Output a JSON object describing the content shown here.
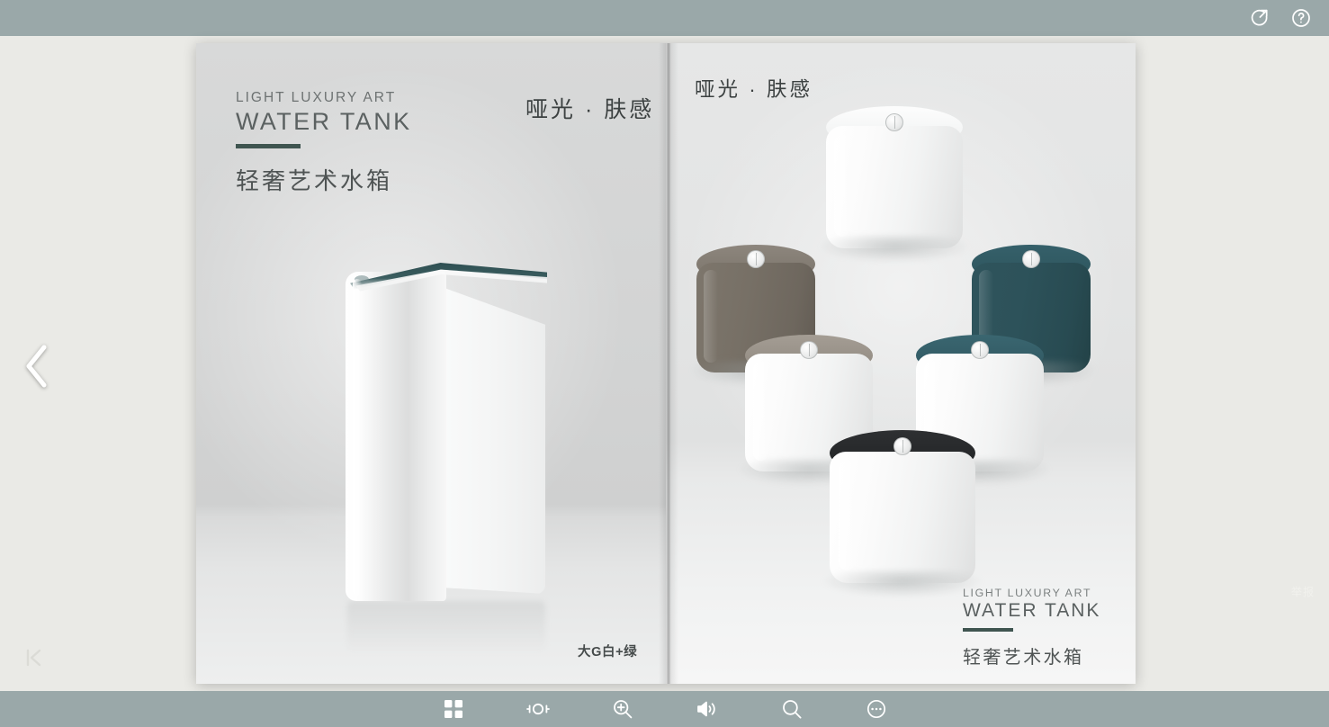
{
  "viewer": {
    "topbar": {
      "icons": [
        {
          "name": "share-icon",
          "label": "Share"
        },
        {
          "name": "help-icon",
          "label": "Help"
        }
      ]
    },
    "bottombar": {
      "icons": [
        {
          "name": "thumbnails-icon",
          "label": "Thumbnails"
        },
        {
          "name": "fit-page-icon",
          "label": "Fit page"
        },
        {
          "name": "zoom-in-icon",
          "label": "Zoom in"
        },
        {
          "name": "sound-icon",
          "label": "Sound"
        },
        {
          "name": "search-icon",
          "label": "Search"
        },
        {
          "name": "more-icon",
          "label": "More"
        }
      ]
    },
    "nav": {
      "prev_label": "Previous page",
      "first_page_label": "First page"
    },
    "report_label": "举报",
    "colors": {
      "bar": "#9aa8a9",
      "background": "#eaeae6",
      "accent_green": "#3f5550",
      "tank_teal": "#2e5057",
      "tank_taupe": "#736c63",
      "tank_black": "#26282a",
      "tank_white": "#ffffff"
    }
  },
  "left_page": {
    "eyebrow": "LIGHT LUXURY ART",
    "headline": "WATER TANK",
    "cn_title": "轻奢艺术水箱",
    "matte_tag": "哑光 · 肤感",
    "caption": "大G白+绿",
    "product": {
      "name": "water-tank",
      "body_color": "#ffffff",
      "top_color": "#2e4f52"
    }
  },
  "right_page": {
    "matte_tag": "哑光 · 肤感",
    "eyebrow": "LIGHT LUXURY ART",
    "headline": "WATER TANK",
    "cn_title": "轻奢艺术水箱",
    "products": [
      {
        "name": "tank-white-top",
        "lid_color": "#f4f5f5",
        "body_color": "#ffffff"
      },
      {
        "name": "tank-taupe",
        "lid_color": "#8a837a",
        "body_color": "#736c63"
      },
      {
        "name": "tank-teal",
        "lid_color": "#32585f",
        "body_color": "#2e5057"
      },
      {
        "name": "tank-white-taupe-lid",
        "lid_color": "#9a938a",
        "body_color": "#ffffff"
      },
      {
        "name": "tank-white-teal-lid",
        "lid_color": "#35606a",
        "body_color": "#ffffff"
      },
      {
        "name": "tank-white-black-lid",
        "lid_color": "#26282a",
        "body_color": "#ffffff"
      }
    ]
  }
}
